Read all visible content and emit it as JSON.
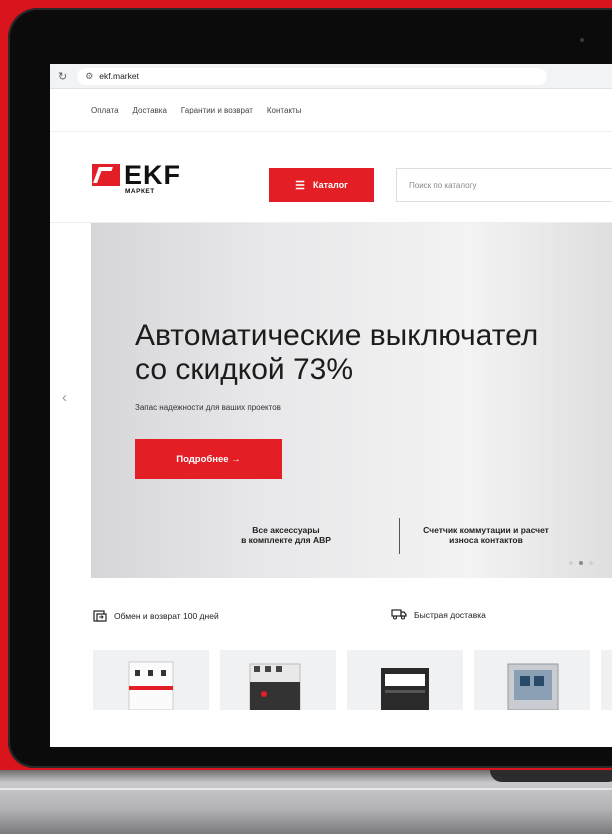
{
  "browser": {
    "url": "ekf.market"
  },
  "top_nav": [
    "Оплата",
    "Доставка",
    "Гарантии и возврат",
    "Контакты"
  ],
  "header": {
    "logo_text": "EKF",
    "logo_sub": "МАРКЕТ",
    "catalog_label": "Каталог",
    "search_placeholder": "Поиск по каталогу"
  },
  "hero": {
    "title": "Автоматические выключател\nсо скидкой 73%",
    "subtitle": "Запас надежности для ваших проектов",
    "cta_label": "Подробнее →",
    "features": [
      "Все аксессуары\nв комплекте для АВР",
      "Счетчик коммутации и расчет\nизноса контактов"
    ],
    "slides_total": 3,
    "slide_active": 2
  },
  "benefits": [
    {
      "icon": "exchange-return-icon",
      "label": "Обмен и возврат 100 дней"
    },
    {
      "icon": "truck-icon",
      "label": "Быстрая доставка"
    }
  ],
  "colors": {
    "brand_red": "#e31e24",
    "background_red": "#d9141c"
  }
}
